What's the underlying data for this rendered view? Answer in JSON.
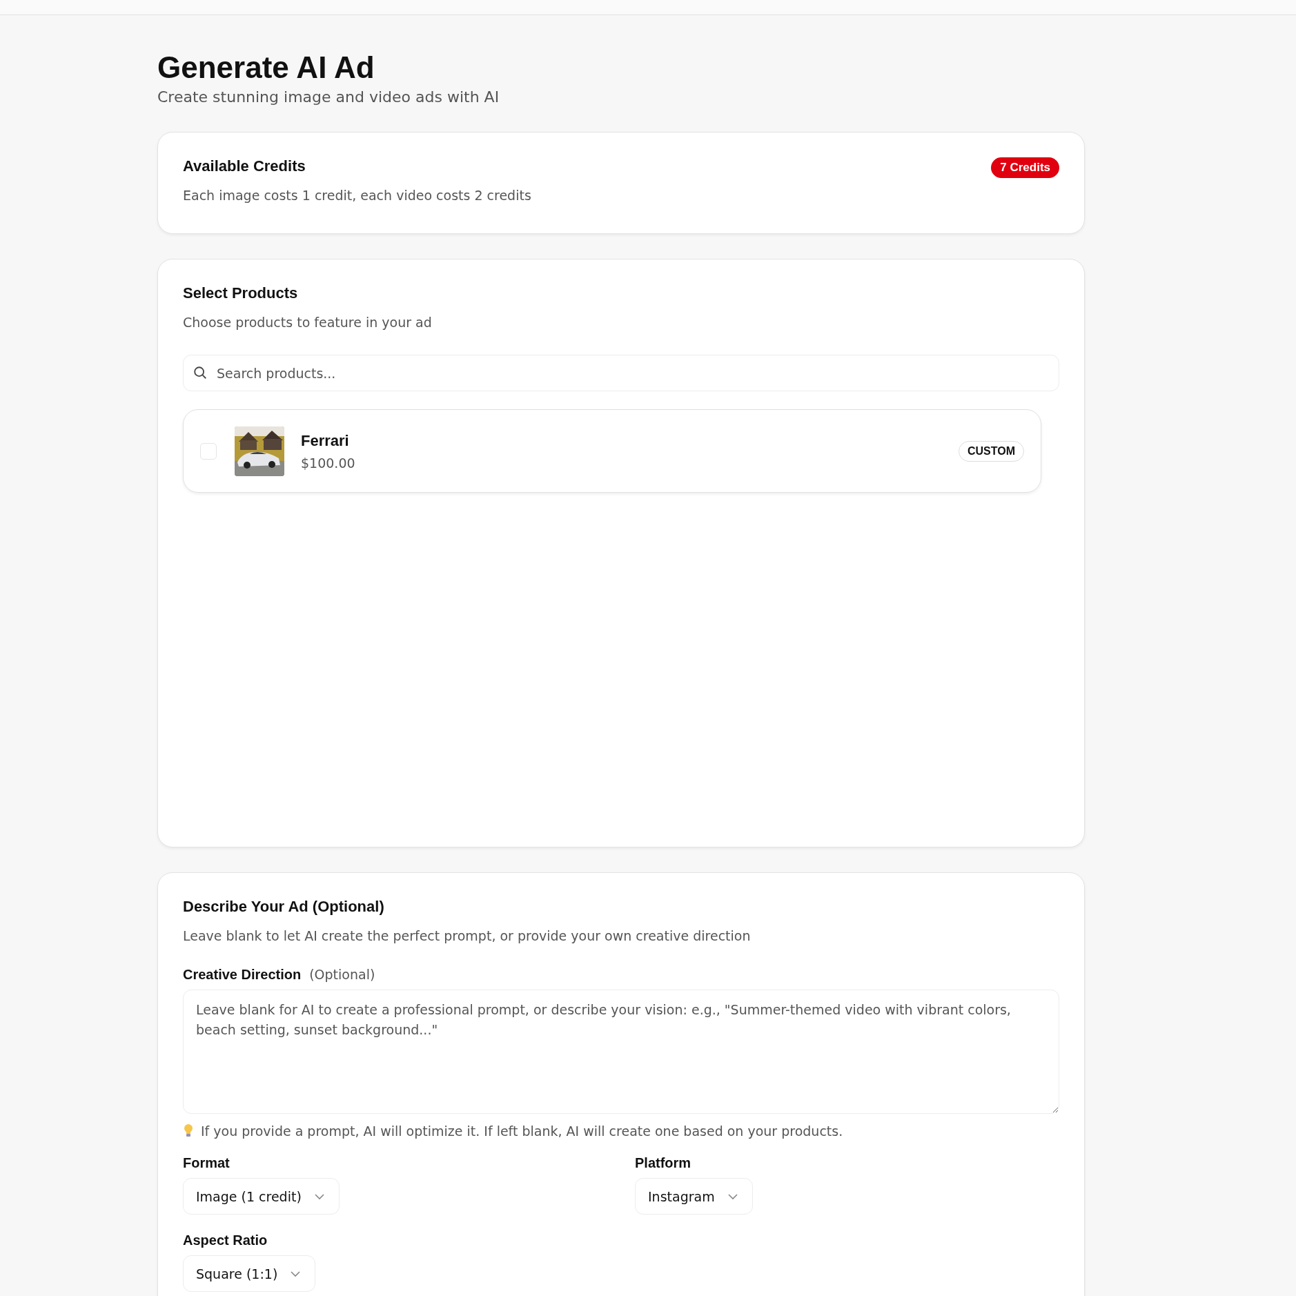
{
  "header": {
    "title": "Generate AI Ad",
    "subtitle": "Create stunning image and video ads with AI"
  },
  "credits": {
    "title": "Available Credits",
    "description": "Each image costs 1 credit, each video costs 2 credits",
    "badge": "7 Credits"
  },
  "products": {
    "title": "Select Products",
    "description": "Choose products to feature in your ad",
    "search": {
      "placeholder": "Search products..."
    },
    "items": [
      {
        "name": "Ferrari",
        "price": "$100.00",
        "tag": "CUSTOM",
        "checked": false
      }
    ]
  },
  "describe": {
    "title": "Describe Your Ad (Optional)",
    "description": "Leave blank to let AI create the perfect prompt, or provide your own creative direction",
    "field": {
      "label": "Creative Direction",
      "note": "(Optional)",
      "placeholder": "Leave blank for AI to create a professional prompt, or describe your vision: e.g., \"Summer-themed video with vibrant colors, beach setting, sunset background...\""
    },
    "hint": "If you provide a prompt, AI will optimize it. If left blank, AI will create one based on your products.",
    "selects": [
      {
        "label": "Format",
        "value": "Image (1 credit)"
      },
      {
        "label": "Platform",
        "value": "Instagram"
      },
      {
        "label": "Aspect Ratio",
        "value": "Square (1:1)"
      }
    ]
  }
}
